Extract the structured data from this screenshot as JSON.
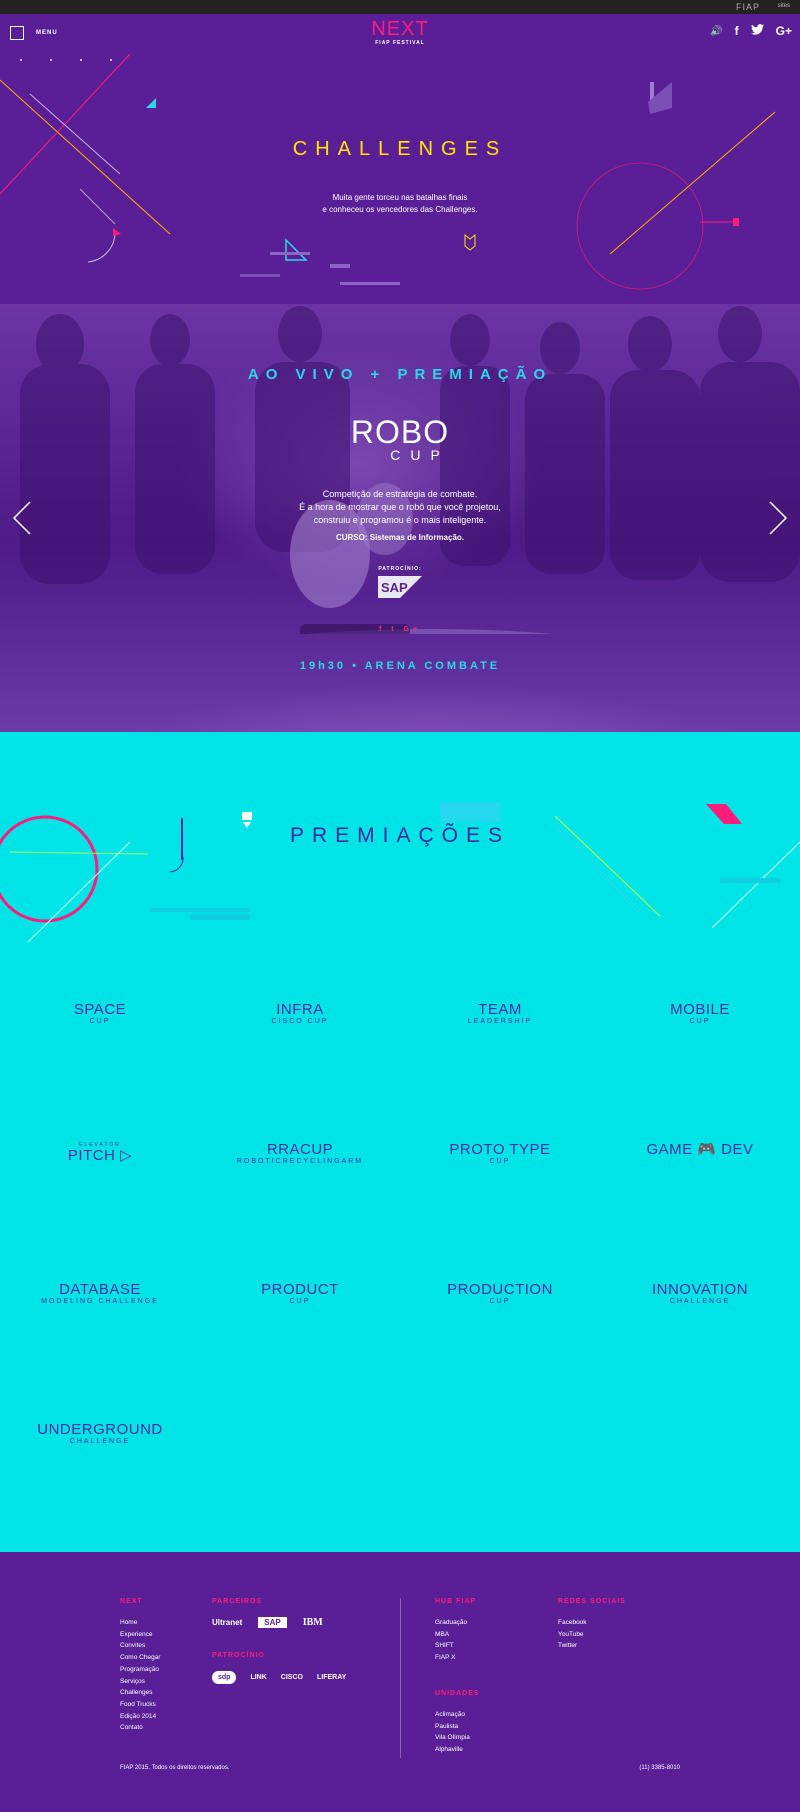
{
  "topbar": {
    "brand": "FIAP",
    "sites": "sites"
  },
  "header": {
    "menu_label": "MENU",
    "logo_text": "NEXT",
    "logo_sub": "FIAP FESTIVAL",
    "social": [
      "facebook-icon",
      "twitter-icon",
      "google-plus-icon"
    ],
    "social_glyphs": {
      "sound": "🔊",
      "facebook": "f",
      "twitter": "t",
      "google": "G+"
    }
  },
  "hero": {
    "title": "CHALLENGES",
    "text_line1": "Muita gente torceu nas batalhas finais",
    "text_line2": "e conheceu os vencedores das Challenges."
  },
  "slide": {
    "title": "AO VIVO + PREMIAÇÃO",
    "logo_main": "ROBO",
    "logo_sub": "CUP",
    "desc_line1": "Competição de estratégia de combate.",
    "desc_line2": "É a hora de mostrar que o robô que você projetou,",
    "desc_line3": "construiu e programou é o mais inteligente.",
    "course": "CURSO: Sistemas de Informação.",
    "sponsor_label": "PATROCÍNIO:",
    "sponsor": "SAP",
    "social": "f  t  G+",
    "time": "19h30",
    "place": "ARENA COMBATE"
  },
  "awards": {
    "title": "PREMIAÇÕES",
    "items": [
      {
        "top": "",
        "main": "SPACE",
        "sub": "CUP"
      },
      {
        "top": "",
        "main": "INFRA",
        "sub": "CISCO CUP"
      },
      {
        "top": "",
        "main": "TEAM",
        "sub": "LEADERSHIP"
      },
      {
        "top": "",
        "main": "MOBILE",
        "sub": "CUP"
      },
      {
        "top": "ELEVATOR",
        "main": "PITCH ▷",
        "sub": ""
      },
      {
        "top": "",
        "main": "RRACUP",
        "sub": "ROBOTICRECYCLINGARM"
      },
      {
        "top": "",
        "main": "PROTO TYPE",
        "sub": "CUP"
      },
      {
        "top": "",
        "main": "GAME 🎮 DEV",
        "sub": ""
      },
      {
        "top": "",
        "main": "DATABASE",
        "sub": "MODELING CHALLENGE"
      },
      {
        "top": "",
        "main": "PRODUCT",
        "sub": "CUP"
      },
      {
        "top": "",
        "main": "PRODUCTION",
        "sub": "CUP"
      },
      {
        "top": "",
        "main": "INNOVATION",
        "sub": "CHALLENGE"
      },
      {
        "top": "",
        "main": "UNDERGROUND",
        "sub": "CHALLENGE"
      }
    ]
  },
  "footer": {
    "next": {
      "heading": "NEXT",
      "links": [
        "Home",
        "Experience",
        "Convites",
        "Como Chegar",
        "Programação",
        "Serviços",
        "Challenges",
        "Food Trucks",
        "Edição 2014",
        "Contato"
      ]
    },
    "parceiros": {
      "heading": "PARCEIROS",
      "items": [
        "Ultranet",
        "SAP",
        "IBM"
      ]
    },
    "patrocinio": {
      "heading": "PATROCÍNIO",
      "items": [
        "sdp",
        "LINK",
        "CISCO",
        "LIFERAY"
      ]
    },
    "hub": {
      "heading": "HUB FIAP",
      "links": [
        "Graduação",
        "MBA",
        "SHIFT",
        "FIAP X"
      ]
    },
    "unidades": {
      "heading": "UNIDADES",
      "links": [
        "Aclimação",
        "Paulista",
        "Vila Olímpia",
        "Alphaville"
      ]
    },
    "redes": {
      "heading": "REDES SOCIAIS",
      "links": [
        "Facebook",
        "YouTube",
        "Twitter"
      ]
    },
    "copyright": "FIAP 2015. Todos os direitos reservados.",
    "phone": "(11) 3385-8010"
  },
  "colors": {
    "purple": "#5a1f96",
    "pink": "#ff1c7b",
    "yellow": "#ffe500",
    "cyan": "#00e4e8",
    "navy": "#3b2a98"
  }
}
